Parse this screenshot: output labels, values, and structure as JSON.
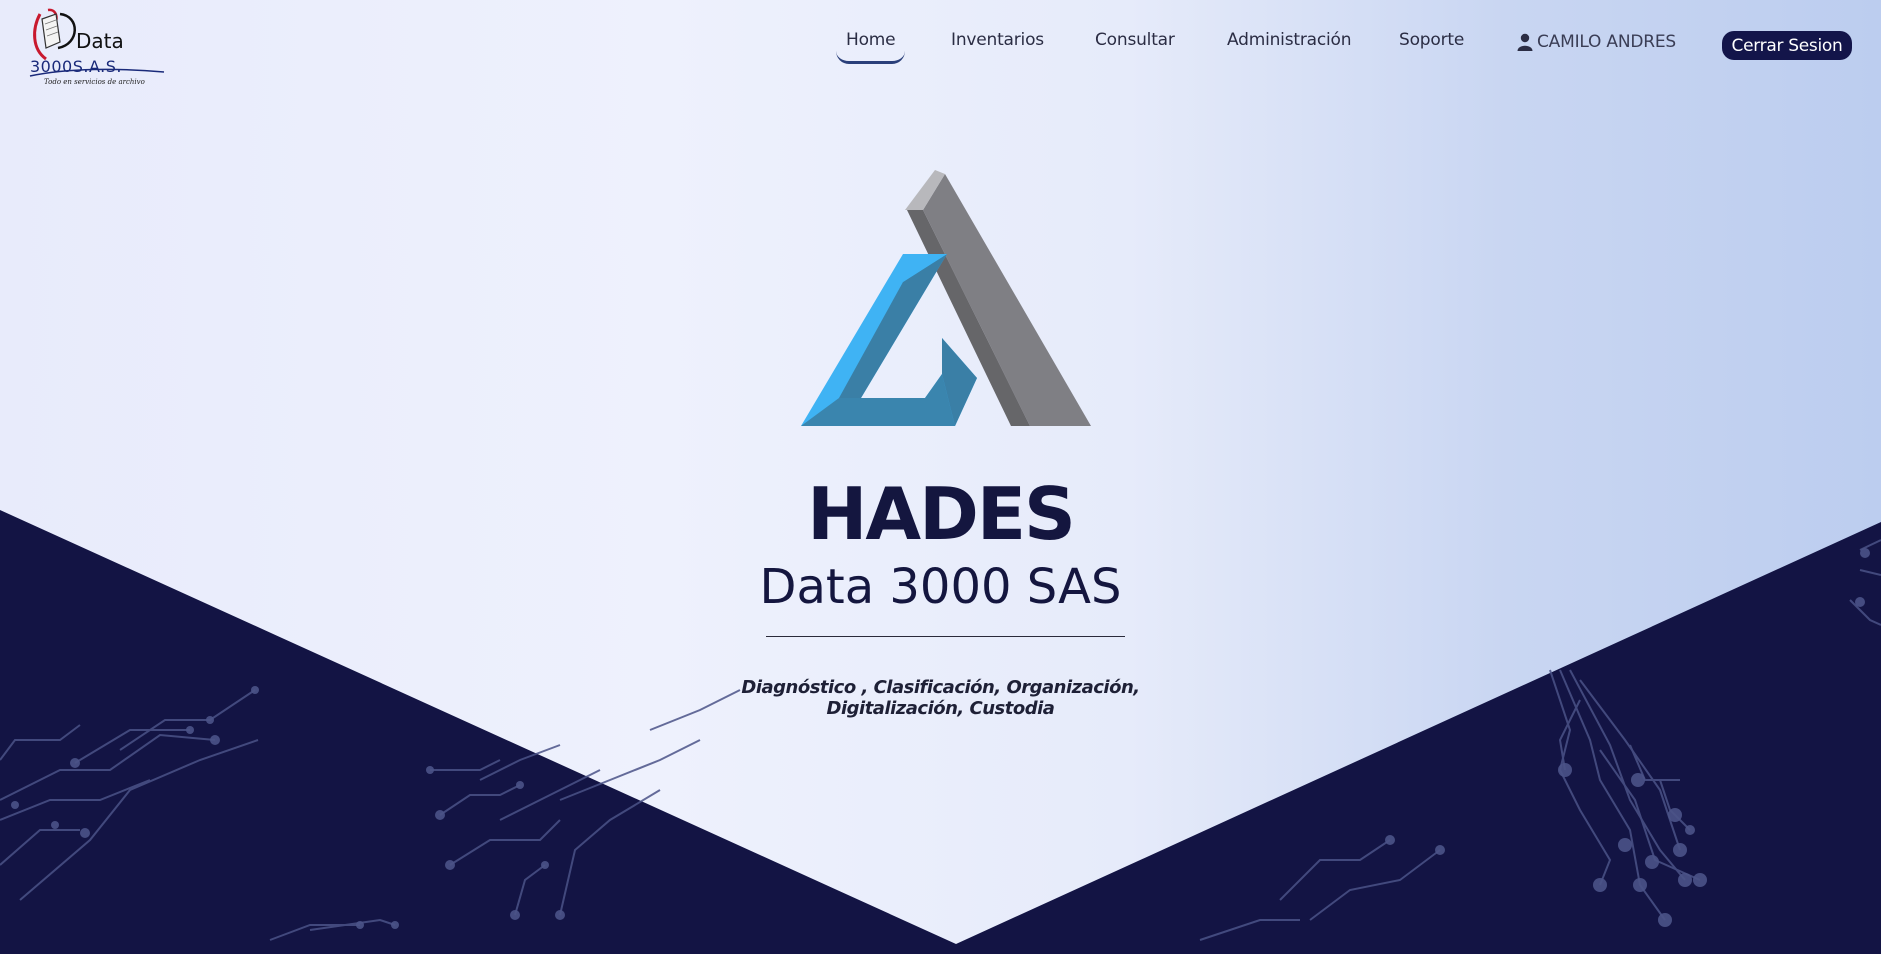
{
  "logo": {
    "brand_main": "Data",
    "brand_sub": "3000S.A.S.",
    "slogan": "Todo en servicios de archivo"
  },
  "nav": {
    "items": [
      {
        "label": "Home",
        "active": true
      },
      {
        "label": "Inventarios",
        "active": false
      },
      {
        "label": "Consultar",
        "active": false
      },
      {
        "label": "Administración",
        "active": false
      },
      {
        "label": "Soporte",
        "active": false
      }
    ],
    "user": {
      "icon": "user-icon",
      "name": "CAMILO ANDRES"
    },
    "logout_label": "Cerrar Sesion"
  },
  "hero": {
    "title": "HADES",
    "subtitle": "Data 3000 SAS",
    "tagline_line1": "Diagnóstico , Clasificación, Organización,",
    "tagline_line2": "Digitalización, Custodia"
  },
  "colors": {
    "navy": "#13154a",
    "logo_blue": "#3fb3f4",
    "logo_blue_dark": "#3a7fa6",
    "logo_gray": "#6e6e72",
    "text_dark": "#14163f"
  }
}
